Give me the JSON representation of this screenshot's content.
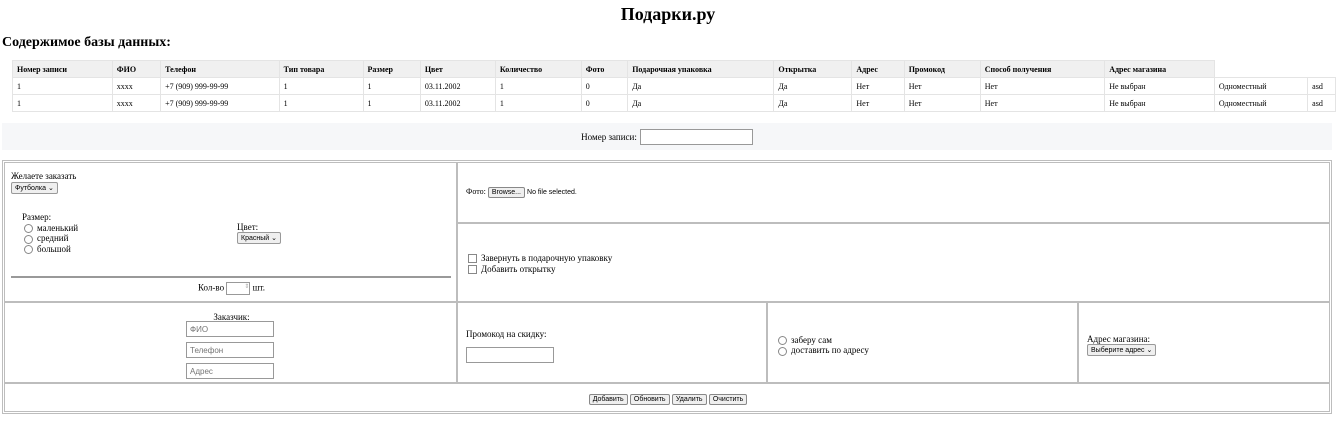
{
  "title": "Подарки.ру",
  "db_heading": "Содержимое базы данных:",
  "table": {
    "headers": [
      "Номер записи",
      "ФИО",
      "Телефон",
      "Тип товара",
      "Размер",
      "Цвет",
      "Количество",
      "Фото",
      "Подарочная упаковка",
      "Открытка",
      "Адрес",
      "Промокод",
      "Способ получения",
      "Адрес магазина"
    ],
    "rows": [
      [
        "1",
        "xxxx",
        "+7 (909) 999-99-99",
        "1",
        "1",
        "03.11.2002",
        "1",
        "0",
        "Да",
        "Да",
        "Нет",
        "Нет",
        "Нет",
        "Не выбран",
        "Одноместный",
        "asd"
      ],
      [
        "1",
        "xxxx",
        "+7 (909) 999-99-99",
        "1",
        "1",
        "03.11.2002",
        "1",
        "0",
        "Да",
        "Да",
        "Нет",
        "Нет",
        "Нет",
        "Не выбран",
        "Одноместный",
        "asd"
      ]
    ]
  },
  "record": {
    "label": "Номер записи:",
    "value": ""
  },
  "form": {
    "order_label": "Желаете заказать",
    "product": "Футболка",
    "size_label": "Размер:",
    "sizes": [
      "маленький",
      "средний",
      "большой"
    ],
    "color_label": "Цвет:",
    "color": "Красный",
    "qty_label": "Кол-во",
    "qty_unit": "шт.",
    "photo_label": "Фото:",
    "browse": "Browse...",
    "no_file": "No file selected.",
    "wrap_label": "Завернуть в подарочную упаковку",
    "card_label": "Добавить открытку",
    "customer_label": "Заказчик:",
    "name_ph": "ФИО",
    "phone_ph": "Телефон",
    "address_ph": "Адрес",
    "promo_label": "Промокод на скидку:",
    "delivery": [
      "заберу сам",
      "доставить по адресу"
    ],
    "store_label": "Адрес магазина:",
    "store": "Выберите адрес"
  },
  "buttons": {
    "add": "Добавить",
    "update": "Обновить",
    "delete": "Удалить",
    "clear": "Очистить"
  }
}
